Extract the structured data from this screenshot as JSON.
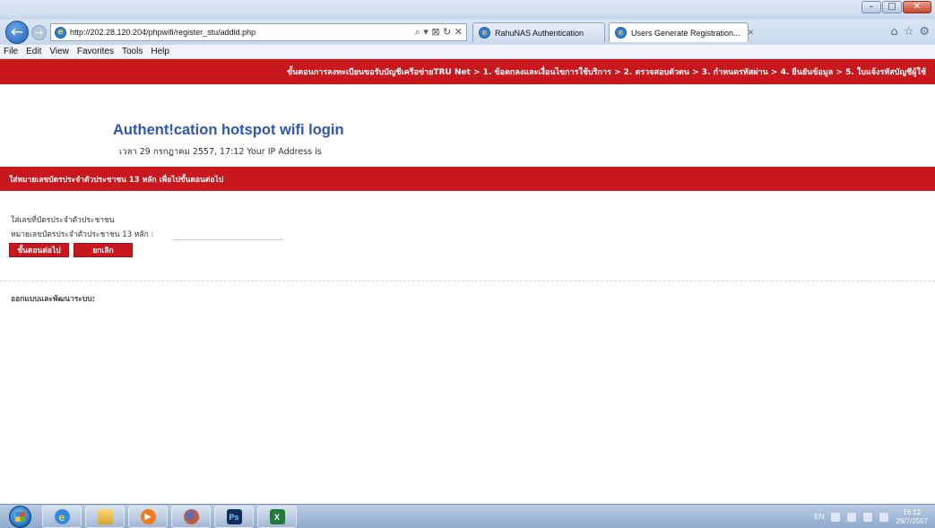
{
  "browser": {
    "address": "http://202.28.120.204/phpwifi/register_stu/addid.php",
    "address_actions": "⌕ ▾ ⊠ ↻ ✕",
    "tabs": [
      {
        "label": "RahuNAS Authentication"
      },
      {
        "label": "Users Generate Registration...",
        "close": "✕"
      }
    ],
    "menu": [
      "File",
      "Edit",
      "View",
      "Favorites",
      "Tools",
      "Help"
    ],
    "window_controls": {
      "minimize": "–",
      "maximize": "□",
      "close": "✕"
    },
    "nav_right_icons": [
      "home-icon",
      "star-icon",
      "gear-icon"
    ]
  },
  "page": {
    "steps": "ขั้นตอนการลงทะเบียนขอรับบัญชีเครือข่ายTRU Net > 1. ข้อตกลงและเงื่อนไขการใช้บริการ > 2. ตรวจสอบตัวตน > 3. กำหนดรหัสผ่าน > 4. ยืนยันข้อมูล > 5. ใบแจ้งรหัสบัญชีผู้ใช้",
    "title": "Authent!cation hotspot wifi login",
    "subtitle": "เวลา 29 กรกฎาคม 2557, 17:12 Your IP Address is",
    "instruction": "ใส่หมายเลขบัตรประจำตัวประชาชน 13 หลัก เพื่อไปขั้นตอนต่อไป",
    "field_heading": "ใส่เลขที่บัตรประจำตัวประชาชน",
    "field_label": "หมายเลขบัตรประจำตัวประชาชน 13 หลัก :",
    "field_value": "",
    "next_button": "ขั้นตอนต่อไป",
    "cancel_button": "ยกเลิก",
    "footer": "ออกแบบและพัฒนาระบบ:"
  },
  "taskbar": {
    "items": [
      "internet-explorer",
      "file-explorer",
      "media-player",
      "firefox",
      "photoshop",
      "excel"
    ],
    "ps_label": "Ps",
    "xl_label": "X",
    "lang": "EN",
    "time": "16:12",
    "date": "29/7/2557"
  },
  "colors": {
    "brand_red": "#c8171d",
    "title_blue": "#2f56b4"
  }
}
